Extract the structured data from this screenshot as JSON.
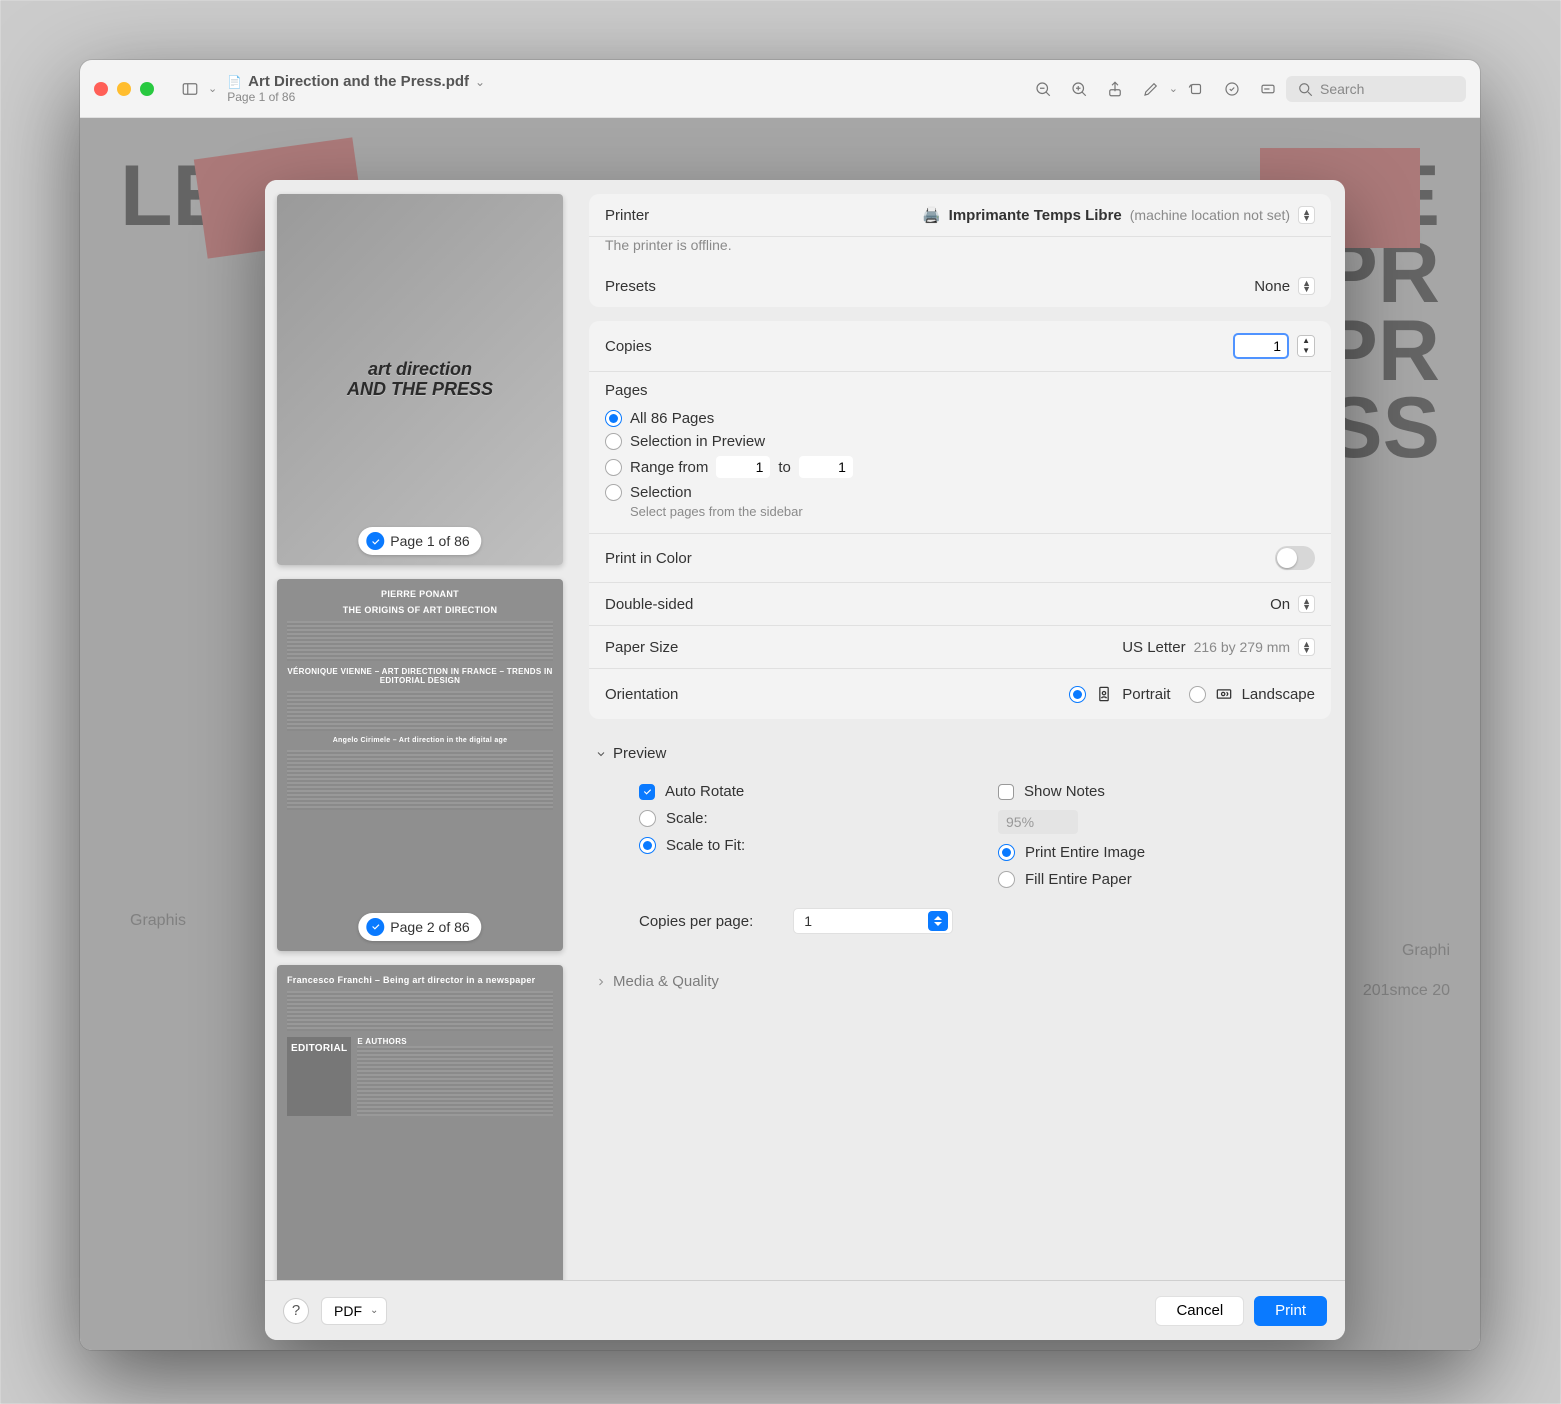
{
  "window": {
    "filename": "Art Direction and the Press.pdf",
    "subtitle": "Page 1 of 86",
    "search_placeholder": "Search"
  },
  "bg": {
    "left_text": "LE D",
    "right_text": "RE\nPR\nPR\nSS",
    "graphis": "Graphis",
    "graphis_r": "Graphi",
    "smce": "201smce 20"
  },
  "thumbs": [
    {
      "badge": "Page 1 of 86",
      "art_line1": "art direction",
      "art_line2": "AND THE PRESS"
    },
    {
      "badge": "Page 2 of 86",
      "h1": "PIERRE PONANT",
      "h2": "THE ORIGINS OF ART DIRECTION",
      "h3": "VÉRONIQUE VIENNE – ART DIRECTION IN FRANCE – TRENDS IN EDITORIAL DESIGN",
      "h4": "Angelo Cirimele – Art direction in the digital age"
    },
    {
      "h1": "Francesco Franchi – Being art director in a newspaper",
      "h2": "EDITORIAL",
      "h3": "E AUTHORS"
    }
  ],
  "printer": {
    "label": "Printer",
    "name": "Imprimante Temps Libre",
    "note": "(machine location not set)",
    "offline": "The printer is offline."
  },
  "presets": {
    "label": "Presets",
    "value": "None"
  },
  "copies": {
    "label": "Copies",
    "value": "1"
  },
  "pages": {
    "label": "Pages",
    "all": "All 86 Pages",
    "selprev": "Selection in Preview",
    "range": "Range from",
    "from": "1",
    "to_label": "to",
    "to": "1",
    "selection": "Selection",
    "hint": "Select pages from the sidebar"
  },
  "color": {
    "label": "Print in Color"
  },
  "duplex": {
    "label": "Double-sided",
    "value": "On"
  },
  "paper": {
    "label": "Paper Size",
    "value": "US Letter",
    "dims": "216 by 279 mm"
  },
  "orientation": {
    "label": "Orientation",
    "portrait": "Portrait",
    "landscape": "Landscape"
  },
  "preview": {
    "title": "Preview",
    "autorotate": "Auto Rotate",
    "shownotes": "Show Notes",
    "scale": "Scale:",
    "scale_val": "95%",
    "scalefit": "Scale to Fit:",
    "entireimg": "Print Entire Image",
    "fillpaper": "Fill Entire Paper",
    "cpp": "Copies per page:",
    "cpp_val": "1"
  },
  "media": {
    "title": "Media & Quality"
  },
  "footer": {
    "pdf": "PDF",
    "cancel": "Cancel",
    "print": "Print"
  }
}
